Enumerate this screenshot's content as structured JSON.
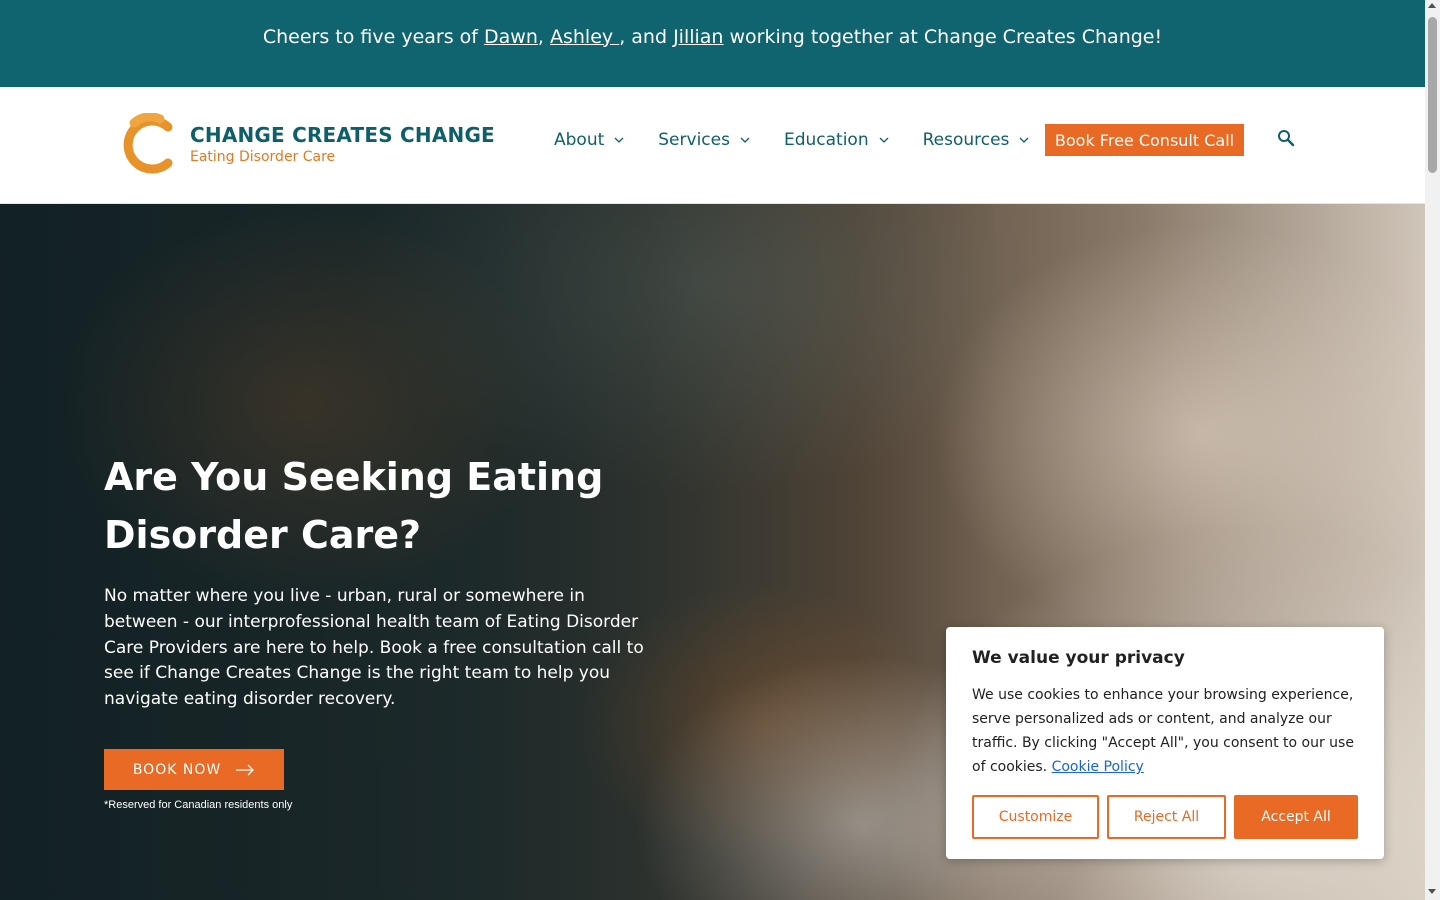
{
  "announcement": {
    "prefix": "Cheers to five years of ",
    "name1": "Dawn",
    "sep1": ", ",
    "name2": "Ashley ",
    "sep2": ", and ",
    "name3": "Jillian",
    "suffix": " working together at Change Creates Change!"
  },
  "header": {
    "logo_title": "CHANGE CREATES CHANGE",
    "logo_subtitle": "Eating Disorder Care",
    "nav": [
      {
        "label": "About"
      },
      {
        "label": "Services"
      },
      {
        "label": "Education"
      },
      {
        "label": "Resources"
      }
    ],
    "cta_label": "Book Free Consult Call",
    "search_icon": "search-icon"
  },
  "hero": {
    "title": "Are You Seeking Eating Disorder Care?",
    "text": "No matter where you live - urban, rural or somewhere in between - our interprofessional health team of Eating Disorder Care Providers are here to help. Book a free consultation call to see if Change Creates Change is the right team to help you navigate eating disorder recovery.",
    "button_label": "BOOK NOW",
    "note": "*Reserved for Canadian residents only"
  },
  "cookie": {
    "title": "We value your privacy",
    "text": "We use cookies to enhance your browsing experience, serve personalized ads or content, and analyze our traffic. By clicking \"Accept All\", you consent to our use of cookies. ",
    "link": "Cookie Policy",
    "customize": "Customize",
    "reject": "Reject All",
    "accept": "Accept All"
  },
  "colors": {
    "teal": "#0f6470",
    "orange": "#e86a24",
    "link_blue": "#1863dc"
  }
}
